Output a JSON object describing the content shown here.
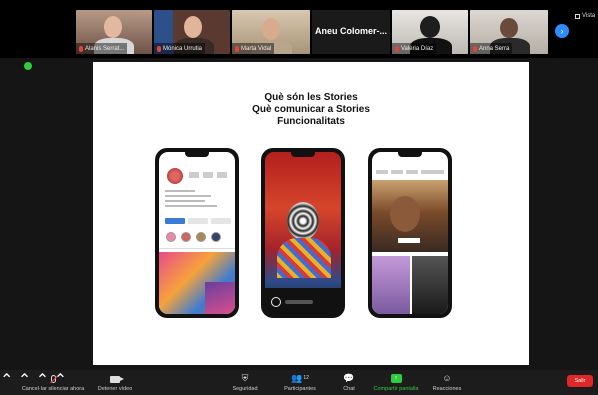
{
  "participants": [
    {
      "name": "Alanis Serrat..."
    },
    {
      "name": "Mónica Urrutia"
    },
    {
      "name": "Marta Vidal"
    },
    {
      "name": "Aneu Colomer-..."
    },
    {
      "name": "Valèria Díaz"
    },
    {
      "name": "Anna Serra"
    }
  ],
  "view_label": "Vista",
  "slide": {
    "title_lines": [
      "Què són les Stories",
      "Què comunicar a Stories",
      "Funcionalitats"
    ]
  },
  "toolbar": {
    "mute_label": "Cancel·lar silenciar ahora",
    "video_label": "Detener vídeo",
    "security_label": "Seguridad",
    "participants_label": "Participantes",
    "participants_count": "12",
    "chat_label": "Chat",
    "share_label": "Compartir pantalla",
    "reactions_label": "Reacciones",
    "leave_label": "Salir"
  },
  "colors": {
    "share_green": "#2ecc40",
    "leave_red": "#e02828",
    "accent_blue": "#2d8cff"
  }
}
